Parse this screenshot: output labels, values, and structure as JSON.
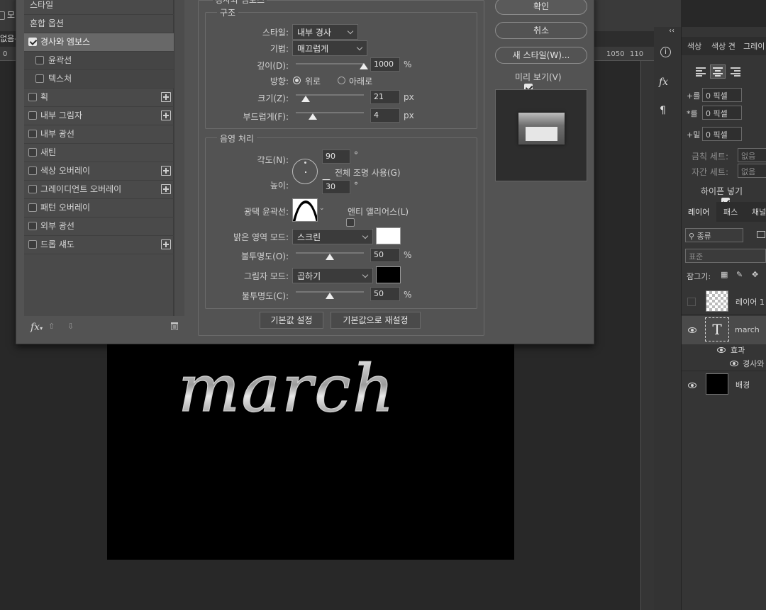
{
  "topbar": {
    "checkbox_label": "모",
    "tab_left": "없음-"
  },
  "ruler": {
    "left_ticks": [
      "0"
    ],
    "right_ticks": [
      "1050",
      "110"
    ]
  },
  "canvas": {
    "text": "march"
  },
  "dialog": {
    "partial_title": "경사와 엠보스",
    "left_list": {
      "items": [
        {
          "label": "스타일",
          "check": false
        },
        {
          "label": "혼합 옵션",
          "check": false
        },
        {
          "label": "경사와 엠보스",
          "check": true,
          "checked": true
        },
        {
          "label": "윤곽선",
          "check": true,
          "checked": false
        },
        {
          "label": "텍스처",
          "check": true,
          "checked": false
        },
        {
          "label": "획",
          "check": true,
          "checked": false,
          "plus": true
        },
        {
          "label": "내부 그림자",
          "check": true,
          "checked": false,
          "plus": true
        },
        {
          "label": "내부 광선",
          "check": true,
          "checked": false
        },
        {
          "label": "새틴",
          "check": true,
          "checked": false
        },
        {
          "label": "색상 오버레이",
          "check": true,
          "checked": false,
          "plus": true
        },
        {
          "label": "그레이디언트 오버레이",
          "check": true,
          "checked": false,
          "plus": true
        },
        {
          "label": "패턴 오버레이",
          "check": true,
          "checked": false
        },
        {
          "label": "외부 광선",
          "check": true,
          "checked": false
        },
        {
          "label": "드롭 섀도",
          "check": true,
          "checked": false,
          "plus": true
        }
      ],
      "fx_label": "fx"
    },
    "structure": {
      "legend": "구조",
      "style_label": "스타일:",
      "style_value": "내부 경사",
      "technique_label": "기법:",
      "technique_value": "매끄럽게",
      "depth_label": "깊이(D):",
      "depth_value": "1000",
      "depth_unit": "%",
      "depth_level": 1.0,
      "direction_label": "방향:",
      "dir_up": "위로",
      "dir_down": "아래로",
      "dir_selected": "up",
      "size_label": "크기(Z):",
      "size_value": "21",
      "size_unit": "px",
      "size_level": 0.14,
      "soften_label": "부드럽게(F):",
      "soften_value": "4",
      "soften_unit": "px",
      "soften_level": 0.24
    },
    "shading": {
      "legend": "음영 처리",
      "angle_label": "각도(N):",
      "angle_value": "90",
      "angle_unit": "°",
      "global_light_label": "전체 조명 사용(G)",
      "global_light_checked": true,
      "altitude_label": "높이:",
      "altitude_value": "30",
      "altitude_unit": "°",
      "gloss_label": "광택 윤곽선:",
      "antialias_label": "앤티 앨리어스(L)",
      "antialias_checked": false,
      "highlight_label": "밝은 영역 모드:",
      "highlight_mode": "스크린",
      "highlight_color": "#ffffff",
      "opacity1_label": "불투명도(O):",
      "opacity1_value": "50",
      "opacity1_unit": "%",
      "opacity1_level": 0.5,
      "shadow_label": "그림자 모드:",
      "shadow_mode": "곱하기",
      "shadow_color": "#000000",
      "opacity2_label": "불투명도(C):",
      "opacity2_value": "50",
      "opacity2_unit": "%",
      "opacity2_level": 0.5
    },
    "default_btn": "기본값 설정",
    "reset_btn": "기본값으로 재설정",
    "ok_btn": "확인",
    "cancel_btn": "취소",
    "new_style_btn": "새 스타일(W)...",
    "preview_label": "미리 보기(V)",
    "preview_checked": true
  },
  "right_panel": {
    "collapse": "‹‹",
    "top_tabs": [
      "색상",
      "색상 견",
      "그레이"
    ],
    "indent": [
      {
        "icon": "+를",
        "value": "0 픽셀"
      },
      {
        "icon": "*를",
        "value": "0 픽셀"
      },
      {
        "icon": "+밑",
        "value": "0 픽셀"
      }
    ],
    "kashida_label": "금칙 세트:",
    "kashida_value": "없음",
    "spacing_label": "자간 세트:",
    "spacing_value": "없음",
    "hyphen_label": "하이픈 넣기",
    "hyphen_checked": true,
    "layer_tabs": [
      "레이어",
      "패스",
      "채널"
    ],
    "kind_label": "종류",
    "blend_mode": "표준",
    "lock_label": "잠그기:",
    "layers": [
      {
        "name": "레이어 1",
        "visible": false
      },
      {
        "name": "march",
        "visible": true
      },
      {
        "name": "효과",
        "visible": true
      },
      {
        "name": "경사와",
        "visible": true
      },
      {
        "name": "배경",
        "visible": true
      }
    ]
  }
}
